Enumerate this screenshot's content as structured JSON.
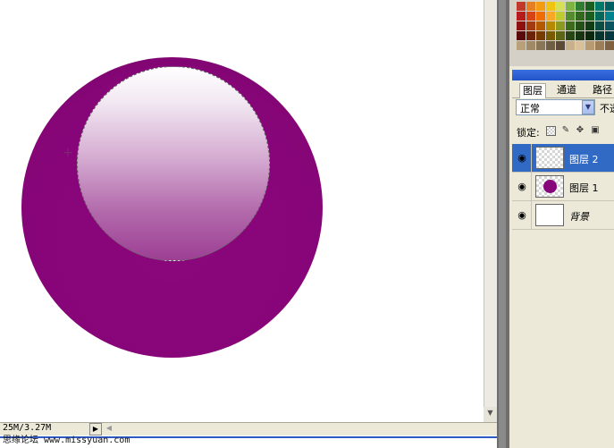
{
  "status": {
    "doc_size": "25M/3.27M",
    "watermark": "思缘论坛 www.missyuan.com"
  },
  "layers_panel": {
    "tabs": [
      {
        "label": "图层"
      },
      {
        "label": "通道"
      },
      {
        "label": "路径"
      }
    ],
    "blend_mode": "正常",
    "opacity_label": "不透",
    "lock_label": "锁定:",
    "layers": [
      {
        "name": "图层 2",
        "selected": true,
        "visible": true,
        "thumb": "transparent"
      },
      {
        "name": "图层 1",
        "selected": false,
        "visible": true,
        "thumb": "purple-dot"
      },
      {
        "name": "背景",
        "selected": false,
        "visible": true,
        "thumb": "white"
      }
    ]
  },
  "colors": {
    "orb": "#860577",
    "selection_highlight": "#316ac5",
    "panel_bg": "#ece9d8"
  },
  "icons": {
    "visibility": "eye-icon",
    "lock_transparent": "checker-icon",
    "lock_paint": "brush-icon",
    "lock_move": "move-icon",
    "lock_all": "lock-icon",
    "blend_dropdown": "chevron-down-icon"
  }
}
